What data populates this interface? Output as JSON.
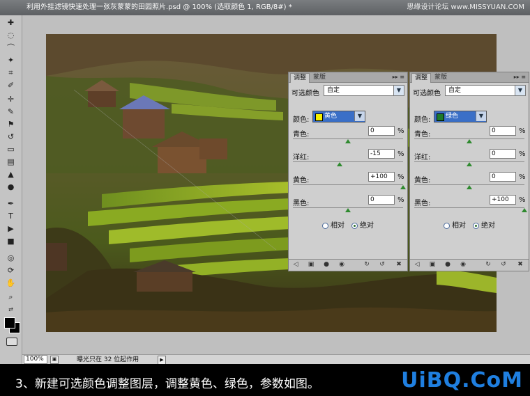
{
  "window": {
    "title": "利用外挂滤镜快速处理一张灰蒙蒙的田园照片.psd @ 100% (选取颜色 1, RGB/8#) *",
    "watermark": "思缘设计论坛 www.MISSYUAN.COM"
  },
  "statusbar": {
    "zoom": "100%",
    "info": "曝光只在 32 位起作用"
  },
  "panels": [
    {
      "tab_active": "调整",
      "tab_inactive": "蒙版",
      "title": "可选颜色",
      "preset": "自定",
      "color_label": "颜色:",
      "color": "黄色",
      "swatch_color": "#f5f000",
      "sliders": [
        {
          "label": "青色:",
          "value": "0",
          "unit": "%",
          "fraction": 0.5
        },
        {
          "label": "洋红:",
          "value": "-15",
          "unit": "%",
          "fraction": 0.425
        },
        {
          "label": "黄色:",
          "value": "+100",
          "unit": "%",
          "fraction": 1.0
        },
        {
          "label": "黑色:",
          "value": "0",
          "unit": "%",
          "fraction": 0.5
        }
      ],
      "radio_relative": "相对",
      "radio_absolute": "绝对",
      "selected_method": "绝对"
    },
    {
      "tab_active": "调整",
      "tab_inactive": "蒙版",
      "title": "可选颜色",
      "preset": "自定",
      "color_label": "颜色:",
      "color": "绿色",
      "swatch_color": "#1d7a2a",
      "sliders": [
        {
          "label": "青色:",
          "value": "0",
          "unit": "%",
          "fraction": 0.5
        },
        {
          "label": "洋红:",
          "value": "0",
          "unit": "%",
          "fraction": 0.5
        },
        {
          "label": "黄色:",
          "value": "0",
          "unit": "%",
          "fraction": 0.5
        },
        {
          "label": "黑色:",
          "value": "+100",
          "unit": "%",
          "fraction": 1.0
        }
      ],
      "radio_relative": "相对",
      "radio_absolute": "绝对",
      "selected_method": "绝对"
    }
  ],
  "caption": "3、新建可选颜色调整图层，调整黄色、绿色，参数如图。",
  "logo": "UiBQ.CoM",
  "colors": {
    "accent": "#3a6fc7",
    "logo": "#1f7fe0"
  }
}
